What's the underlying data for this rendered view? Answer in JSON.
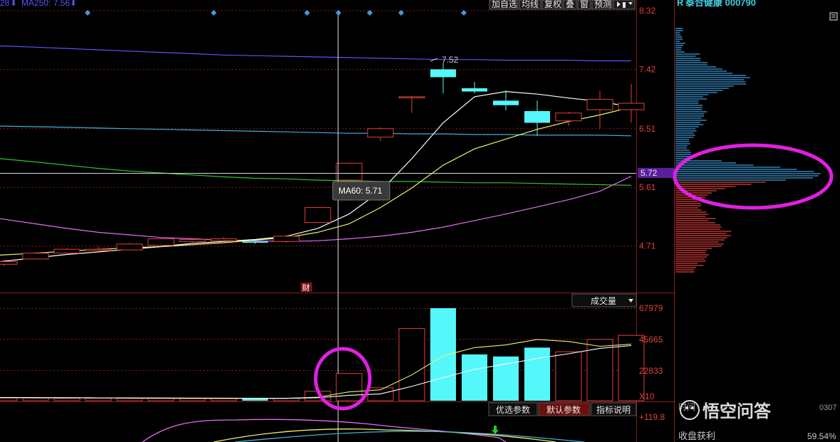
{
  "top_left": {
    "ma_prev": "28",
    "ma250": "MA250: 7.56"
  },
  "toolbar": [
    "加自选",
    "均线",
    "复权",
    "叠",
    "窗",
    "预测"
  ],
  "stock": {
    "prefix": "R",
    "name": "泰合健康 000790"
  },
  "price_axis": [
    "8.32",
    "7.42",
    "6.51",
    "5.72",
    "5.61",
    "4.71"
  ],
  "current_price_label": "5.72",
  "peak_label": "7.52",
  "tooltip": "MA60: 5.71",
  "fin_marker": "财",
  "volume": {
    "title": "成交量",
    "axis": [
      "67979",
      "45665",
      "22833",
      "X10"
    ]
  },
  "tabs": [
    "优选参数",
    "默认参数",
    "指标说明"
  ],
  "indicator": {
    "value": "+119.8"
  },
  "profit": {
    "label": "收盘获利",
    "value": "59.54%"
  },
  "watermark": "悟空问答",
  "time_fragment": "时间",
  "code_fragment": "0307",
  "colors": {
    "up": "#e0413e",
    "down": "#54f7fa",
    "ma5": "#ffffff",
    "ma10": "#f2f26a",
    "ma20": "#e46cf0",
    "ma60": "#2ec52e",
    "ma120": "#3fb0d8",
    "ma250": "#5555ff",
    "highlight": "#e020e0"
  },
  "chart_data": [
    {
      "type": "candlestick",
      "title": "",
      "ylabel": "",
      "ylim": [
        4.0,
        8.32
      ],
      "candles": [
        {
          "o": 4.43,
          "c": 4.47,
          "h": 4.5,
          "l": 4.4
        },
        {
          "o": 4.51,
          "c": 4.6,
          "h": 4.62,
          "l": 4.5
        },
        {
          "o": 4.6,
          "c": 4.66,
          "h": 4.68,
          "l": 4.58
        },
        {
          "o": 4.64,
          "c": 4.66,
          "h": 4.7,
          "l": 4.62
        },
        {
          "o": 4.65,
          "c": 4.74,
          "h": 4.76,
          "l": 4.64
        },
        {
          "o": 4.72,
          "c": 4.82,
          "h": 4.84,
          "l": 4.7
        },
        {
          "o": 4.78,
          "c": 4.81,
          "h": 4.82,
          "l": 4.75
        },
        {
          "o": 4.79,
          "c": 4.82,
          "h": 4.85,
          "l": 4.78
        },
        {
          "o": 4.78,
          "c": 4.76,
          "h": 4.8,
          "l": 4.74
        },
        {
          "o": 4.78,
          "c": 4.86,
          "h": 4.88,
          "l": 4.76
        },
        {
          "o": 5.07,
          "c": 5.3,
          "h": 5.31,
          "l": 5.06
        },
        {
          "o": 5.72,
          "c": 5.98,
          "h": 5.99,
          "l": 5.7
        },
        {
          "o": 6.38,
          "c": 6.51,
          "h": 6.53,
          "l": 6.32
        },
        {
          "o": 7.0,
          "c": 7.0,
          "h": 7.01,
          "l": 6.75
        },
        {
          "o": 7.42,
          "c": 7.3,
          "h": 7.52,
          "l": 7.05
        },
        {
          "o": 7.13,
          "c": 7.08,
          "h": 7.23,
          "l": 7.05
        },
        {
          "o": 6.94,
          "c": 6.87,
          "h": 7.1,
          "l": 6.79
        },
        {
          "o": 6.78,
          "c": 6.6,
          "h": 6.94,
          "l": 6.4
        },
        {
          "o": 6.63,
          "c": 6.75,
          "h": 6.77,
          "l": 6.55
        },
        {
          "o": 6.8,
          "c": 6.96,
          "h": 7.09,
          "l": 6.51
        },
        {
          "o": 6.8,
          "c": 6.9,
          "h": 7.2,
          "l": 6.6
        }
      ],
      "ma_lines": [
        {
          "key": "ma250",
          "values": [
            7.78,
            7.76,
            7.74,
            7.72,
            7.7,
            7.68,
            7.66,
            7.64,
            7.63,
            7.62,
            7.61,
            7.6,
            7.59,
            7.58,
            7.57,
            7.57,
            7.56,
            7.56,
            7.56,
            7.55,
            7.55
          ]
        },
        {
          "key": "ma120",
          "values": [
            6.55,
            6.54,
            6.53,
            6.52,
            6.51,
            6.5,
            6.49,
            6.48,
            6.47,
            6.46,
            6.45,
            6.44,
            6.44,
            6.43,
            6.43,
            6.42,
            6.42,
            6.41,
            6.41,
            6.41,
            6.4
          ]
        },
        {
          "key": "ma60",
          "values": [
            6.05,
            6.0,
            5.95,
            5.9,
            5.86,
            5.83,
            5.8,
            5.77,
            5.75,
            5.74,
            5.72,
            5.71,
            5.7,
            5.7,
            5.69,
            5.68,
            5.68,
            5.67,
            5.66,
            5.65,
            5.64
          ]
        },
        {
          "key": "ma20",
          "values": [
            5.13,
            5.05,
            4.98,
            4.92,
            4.88,
            4.84,
            4.82,
            4.8,
            4.79,
            4.78,
            4.79,
            4.82,
            4.86,
            4.92,
            5.0,
            5.1,
            5.2,
            5.31,
            5.42,
            5.55,
            5.78
          ]
        },
        {
          "key": "ma10",
          "values": [
            4.57,
            4.6,
            4.63,
            4.66,
            4.68,
            4.7,
            4.73,
            4.76,
            4.8,
            4.84,
            4.92,
            5.05,
            5.3,
            5.6,
            5.95,
            6.2,
            6.35,
            6.5,
            6.62,
            6.72,
            6.84
          ]
        },
        {
          "key": "ma5",
          "values": [
            4.47,
            4.53,
            4.58,
            4.62,
            4.66,
            4.7,
            4.75,
            4.78,
            4.81,
            4.86,
            4.98,
            5.2,
            5.55,
            6.05,
            6.6,
            7.0,
            7.08,
            7.04,
            6.98,
            6.93,
            6.84
          ]
        }
      ]
    },
    {
      "type": "bar",
      "title": "成交量",
      "ylim": [
        0,
        67979
      ],
      "values": [
        2000,
        2000,
        1800,
        1800,
        1700,
        1700,
        1600,
        1600,
        1500,
        1800,
        7000,
        20000,
        9500,
        53000,
        67979,
        34000,
        32500,
        39000,
        36000,
        45000,
        48000
      ],
      "ma_lines": [
        {
          "key": "ma5",
          "values": [
            2400,
            2300,
            2200,
            2100,
            2000,
            1900,
            1800,
            1750,
            1700,
            1700,
            2600,
            6500,
            8000,
            19000,
            33000,
            39000,
            41000,
            45000,
            43500,
            40000,
            41500
          ]
        },
        {
          "key": "ma10",
          "values": [
            2300,
            2200,
            2150,
            2100,
            2050,
            2000,
            1950,
            1900,
            1850,
            1800,
            2200,
            4000,
            5000,
            10500,
            17000,
            23000,
            27000,
            31000,
            34500,
            38500,
            40500
          ]
        }
      ]
    }
  ]
}
